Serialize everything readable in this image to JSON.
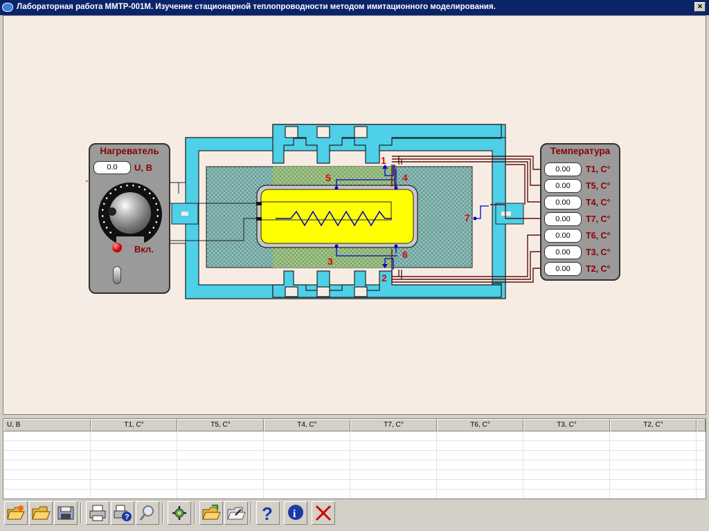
{
  "window": {
    "title": "Лабораторная работа ММТР-001М. Изучение стационарной теплопроводности методом имитационного моделирования.",
    "close_glyph": "×"
  },
  "heater": {
    "title": "Нагреватель",
    "voltage_value": "0.0",
    "voltage_label": "U, В",
    "power_label": "Вкл."
  },
  "temperature": {
    "title": "Температура",
    "rows": [
      {
        "value": "0.00",
        "label": "Т1, С°"
      },
      {
        "value": "0.00",
        "label": "Т5, С°"
      },
      {
        "value": "0.00",
        "label": "Т4, С°"
      },
      {
        "value": "0.00",
        "label": "Т7, С°"
      },
      {
        "value": "0.00",
        "label": "Т6, С°"
      },
      {
        "value": "0.00",
        "label": "Т3, С°"
      },
      {
        "value": "0.00",
        "label": "Т2, С°"
      }
    ]
  },
  "schema_labels": [
    "1",
    "2",
    "3",
    "4",
    "5",
    "6",
    "7"
  ],
  "table": {
    "columns": [
      "U, В",
      "T1, C°",
      "T5, C°",
      "T4, C°",
      "T7, C°",
      "T6, C°",
      "T3, C°",
      "T2, C°"
    ],
    "rows": []
  },
  "toolbar": {
    "icons": [
      "new-icon",
      "open-icon",
      "save-icon",
      "print-icon",
      "print-help-icon",
      "preview-icon",
      "settings-icon",
      "import-icon",
      "export-icon",
      "help-icon",
      "info-icon",
      "exit-icon"
    ]
  },
  "colors": {
    "title_bar": "#0a246a",
    "canvas": "#f7ece3",
    "housing": "#4dd0e8",
    "insulation": "#8fc0bb",
    "heater_core": "#ffff00",
    "label_red": "#8b0000",
    "marker_red": "#e00000",
    "probe_blue": "#0000cc",
    "wire": "#5a1010"
  }
}
